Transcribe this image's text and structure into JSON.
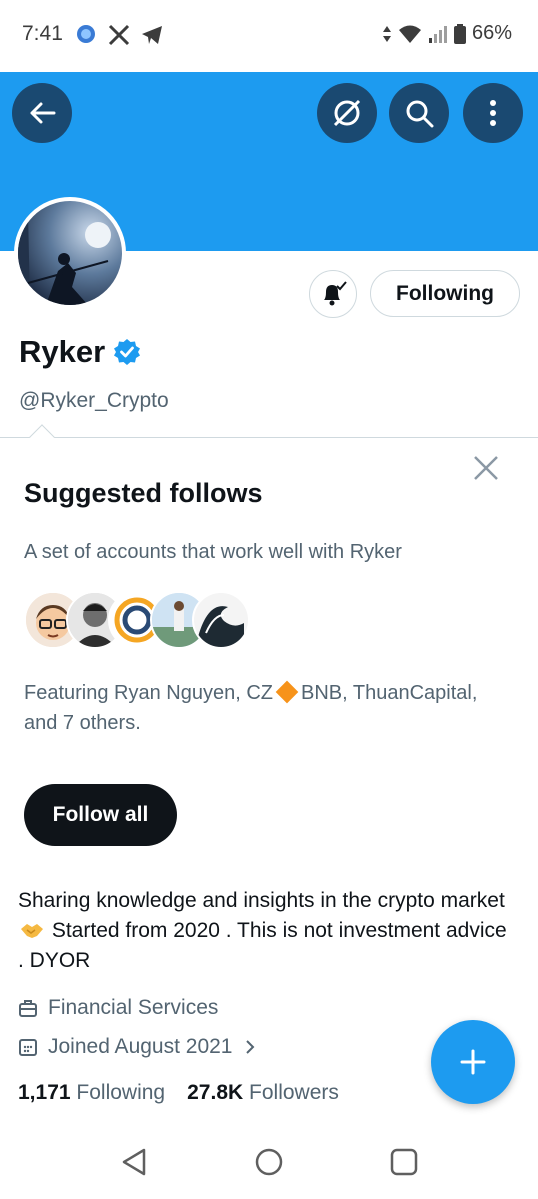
{
  "status_bar": {
    "time": "7:41",
    "battery": "66%",
    "icons": [
      "app-dot-icon",
      "x-logo-icon",
      "telegram-icon",
      "data-arrows-icon",
      "wifi-icon",
      "signal-icon",
      "battery-icon"
    ]
  },
  "header": {
    "banner_color": "#1d9bf0",
    "button_color": "#1a4971",
    "icons": [
      "back-arrow-icon",
      "grok-icon",
      "search-icon",
      "more-vertical-icon"
    ]
  },
  "profile": {
    "name": "Ryker",
    "verified": true,
    "handle": "@Ryker_Crypto",
    "following_button": "Following",
    "bio_part1": "Sharing knowledge and insights in the crypto market",
    "bio_part2": "Started from 2020 . This is not investment advice . DYOR",
    "category": "Financial Services",
    "joined": "Joined August 2021",
    "following_count": "1,171",
    "following_label": "Following",
    "followers_count": "27.8K",
    "followers_label": "Followers"
  },
  "suggested": {
    "title": "Suggested follows",
    "subtitle": "A set of accounts that work well with Ryker",
    "featuring_prefix": "Featuring Ryan Nguyen, CZ",
    "featuring_suffix": "BNB, ThuanCapital, and 7 others.",
    "follow_all": "Follow all"
  },
  "colors": {
    "accent": "#1d9bf0",
    "text_primary": "#0f1419",
    "text_secondary": "#536471",
    "border": "#cfd9de"
  },
  "nav": {
    "icons": [
      "back-triangle-icon",
      "home-circle-icon",
      "recents-square-icon"
    ]
  }
}
